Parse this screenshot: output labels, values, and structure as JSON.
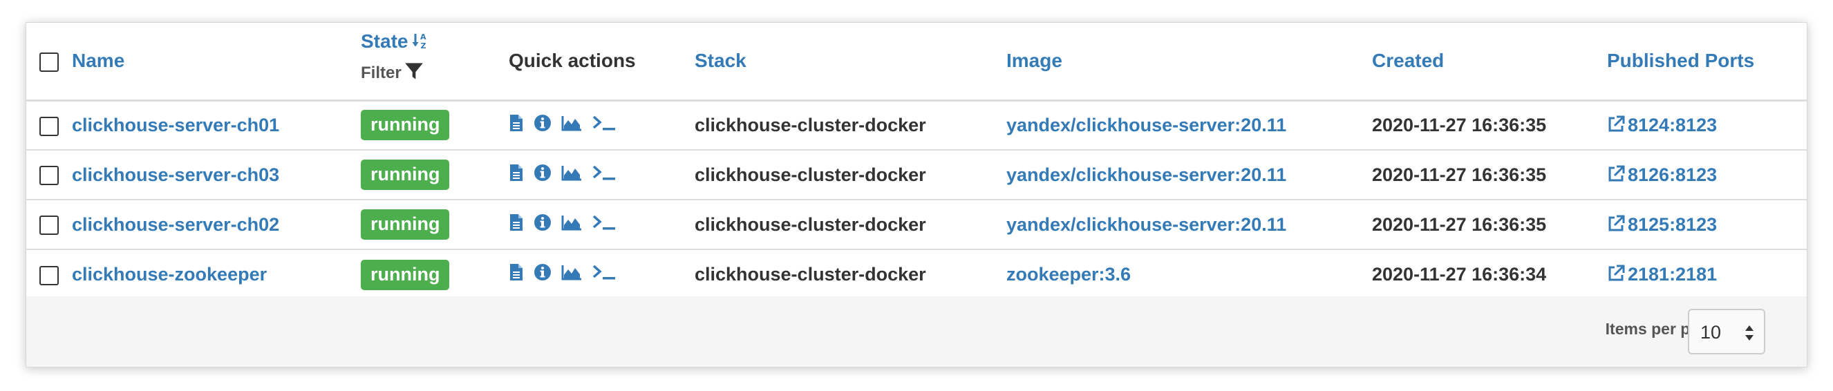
{
  "table": {
    "headers": {
      "name": "Name",
      "state": "State",
      "state_filter": "Filter",
      "quick_actions": "Quick actions",
      "stack": "Stack",
      "image": "Image",
      "created": "Created",
      "published_ports": "Published Ports"
    },
    "rows": [
      {
        "name": "clickhouse-server-ch01",
        "state": "running",
        "stack": "clickhouse-cluster-docker",
        "image": "yandex/clickhouse-server:20.11",
        "created": "2020-11-27 16:36:35",
        "port": "8124:8123"
      },
      {
        "name": "clickhouse-server-ch03",
        "state": "running",
        "stack": "clickhouse-cluster-docker",
        "image": "yandex/clickhouse-server:20.11",
        "created": "2020-11-27 16:36:35",
        "port": "8126:8123"
      },
      {
        "name": "clickhouse-server-ch02",
        "state": "running",
        "stack": "clickhouse-cluster-docker",
        "image": "yandex/clickhouse-server:20.11",
        "created": "2020-11-27 16:36:35",
        "port": "8125:8123"
      },
      {
        "name": "clickhouse-zookeeper",
        "state": "running",
        "stack": "clickhouse-cluster-docker",
        "image": "zookeeper:3.6",
        "created": "2020-11-27 16:36:34",
        "port": "2181:2181"
      }
    ],
    "quick_action_icons": [
      "logs-icon",
      "inspect-icon",
      "stats-icon",
      "console-icon"
    ]
  },
  "footer": {
    "items_per_page_label": "Items per page",
    "items_per_page_value": "10"
  },
  "colors": {
    "link": "#337ab7",
    "running_badge": "#4cae4c",
    "footer_bg": "#f5f5f5"
  }
}
